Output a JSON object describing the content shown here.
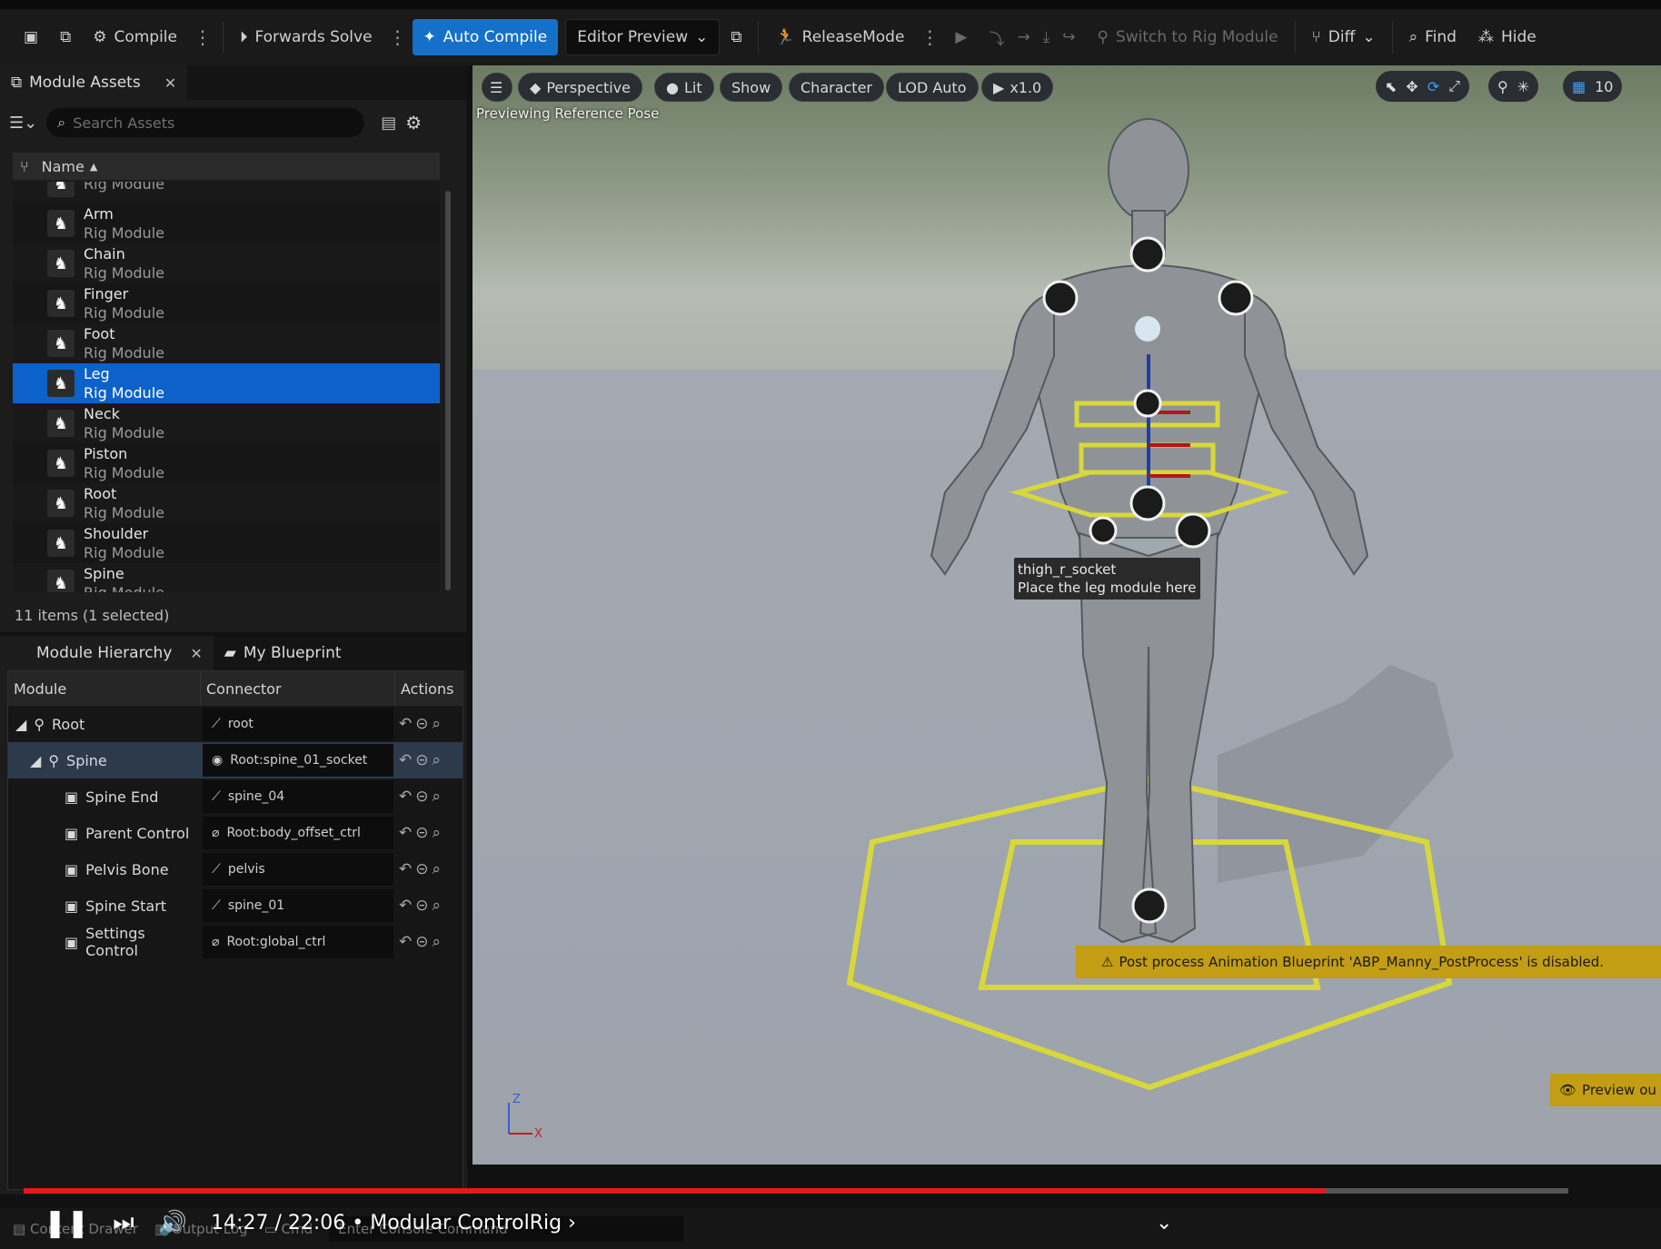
{
  "toolbar": {
    "compile": "Compile",
    "forwards_solve": "Forwards Solve",
    "auto_compile": "Auto Compile",
    "editor_preview": "Editor Preview",
    "release_mode": "ReleaseMode",
    "switch_rig": "Switch to Rig Module",
    "diff": "Diff",
    "find": "Find",
    "hide": "Hide"
  },
  "assets": {
    "tab_label": "Module Assets",
    "search_placeholder": "Search Assets",
    "column_name": "Name",
    "items": [
      {
        "name": "",
        "type": "Rig Module"
      },
      {
        "name": "Arm",
        "type": "Rig Module"
      },
      {
        "name": "Chain",
        "type": "Rig Module"
      },
      {
        "name": "Finger",
        "type": "Rig Module"
      },
      {
        "name": "Foot",
        "type": "Rig Module"
      },
      {
        "name": "Leg",
        "type": "Rig Module",
        "selected": true
      },
      {
        "name": "Neck",
        "type": "Rig Module"
      },
      {
        "name": "Piston",
        "type": "Rig Module"
      },
      {
        "name": "Root",
        "type": "Rig Module"
      },
      {
        "name": "Shoulder",
        "type": "Rig Module"
      },
      {
        "name": "Spine",
        "type": "Rig Module"
      }
    ],
    "count": "11 items (1 selected)"
  },
  "hierarchy": {
    "tab_label": "Module Hierarchy",
    "tab2_label": "My Blueprint",
    "col_module": "Module",
    "col_connector": "Connector",
    "col_actions": "Actions",
    "rows": [
      {
        "module": "Root",
        "connector": "root"
      },
      {
        "module": "Spine",
        "connector": "Root:spine_01_socket",
        "selected": true
      },
      {
        "module": "Spine End",
        "connector": "spine_04"
      },
      {
        "module": "Parent Control",
        "connector": "Root:body_offset_ctrl"
      },
      {
        "module": "Pelvis Bone",
        "connector": "pelvis"
      },
      {
        "module": "Spine Start",
        "connector": "spine_01"
      },
      {
        "module": "Settings Control",
        "connector": "Root:global_ctrl"
      }
    ]
  },
  "viewport": {
    "perspective": "Perspective",
    "lit": "Lit",
    "show": "Show",
    "character": "Character",
    "lod": "LOD Auto",
    "speed": "x1.0",
    "grid_value": "10",
    "preview_label": "Previewing Reference Pose",
    "tooltip_line1": "thigh_r_socket",
    "tooltip_line2": "Place the leg module here",
    "warning": "Post process Animation Blueprint 'ABP_Manny_PostProcess' is disabled.",
    "preview_out": "Preview ou",
    "axis_z": "Z",
    "axis_x": "X"
  },
  "statusbar": {
    "content_drawer": "Content Drawer",
    "output_log": "Output Log",
    "cmd": "Cmd",
    "command_placeholder": "Enter Console Command"
  },
  "player": {
    "time": "14:27 / 22:06",
    "title": "Modular ControlRig",
    "progress": 0.843
  }
}
